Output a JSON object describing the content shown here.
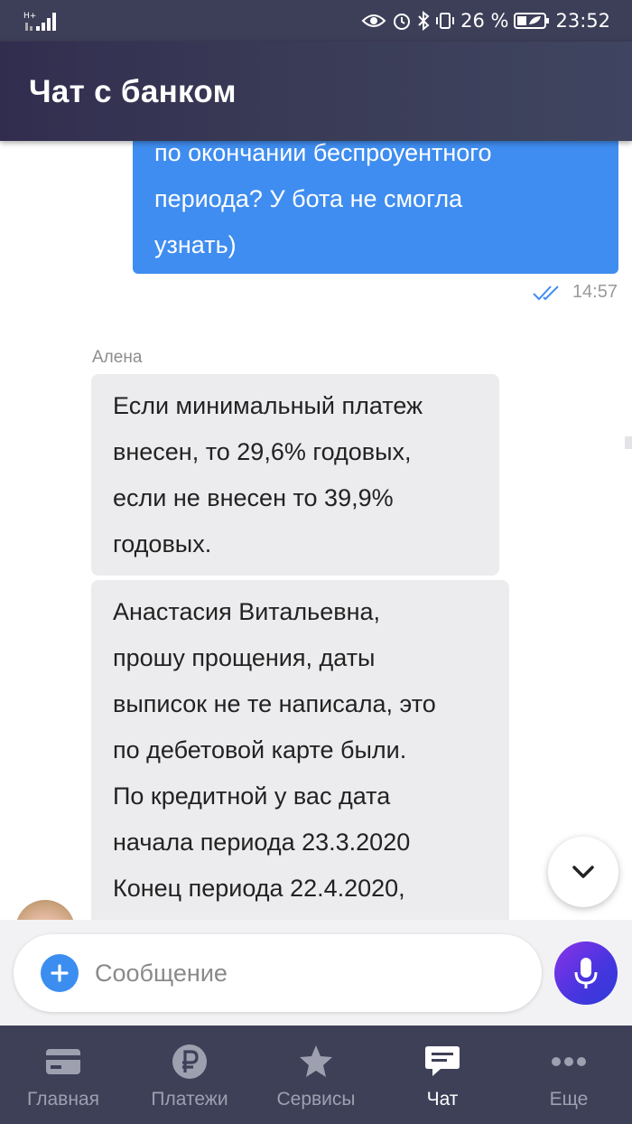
{
  "status_bar": {
    "network": "H+",
    "battery": "26 %",
    "time": "23:52"
  },
  "header": {
    "title": "Чат с банком"
  },
  "chat": {
    "outgoing": {
      "lines": [
        "по окончании беспроуентного",
        "периода? У бота не смогла",
        "узнать)"
      ],
      "time": "14:57"
    },
    "sender": "Алена",
    "incoming": [
      {
        "lines": [
          "Если минимальный платеж",
          "внесен, то 29,6% годовых,",
          "если не внесен то 39,9%",
          "годовых."
        ]
      },
      {
        "lines": [
          "Анастасия Витальевна,",
          "прошу прощения, даты",
          "выписок не те написала, это",
          "по дебетовой карте были.",
          "По кредитной у вас дата",
          "начала периода 23.3.2020",
          "Конец периода 22.4.2020,"
        ]
      }
    ]
  },
  "input": {
    "placeholder": "Сообщение"
  },
  "nav": [
    {
      "label": "Главная",
      "icon": "card-icon"
    },
    {
      "label": "Платежи",
      "icon": "ruble-icon"
    },
    {
      "label": "Сервисы",
      "icon": "star-icon"
    },
    {
      "label": "Чат",
      "icon": "chat-icon",
      "active": true
    },
    {
      "label": "Еще",
      "icon": "more-icon"
    }
  ],
  "colors": {
    "header": "#3a3c57",
    "outgoing_bubble": "#3f8df0",
    "incoming_bubble": "#ececee",
    "mic_button": "#5a35e0",
    "nav_bg": "#3e4058"
  }
}
